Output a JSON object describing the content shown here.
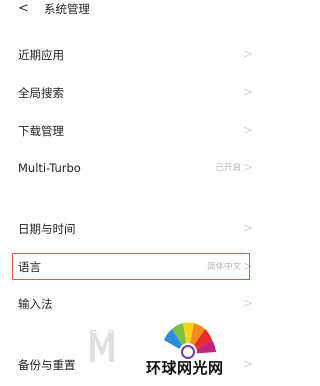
{
  "header": {
    "back_icon": "chevron-left-icon",
    "back_glyph": "<",
    "title": "系统管理"
  },
  "settings": {
    "items": [
      {
        "label": "近期应用",
        "value": ""
      },
      {
        "label": "全局搜索",
        "value": ""
      },
      {
        "label": "下载管理",
        "value": ""
      },
      {
        "label": "Multi-Turbo",
        "value": "已开启"
      },
      {
        "label": "日期与时间",
        "value": ""
      },
      {
        "label": "语言",
        "value": "简体中文"
      },
      {
        "label": "输入法",
        "value": ""
      },
      {
        "label": "备份与重置",
        "value": ""
      }
    ],
    "chevron_glyph": ">"
  },
  "highlight": {
    "color": "#d75a5a",
    "target": "语言"
  },
  "watermark": {
    "text": "环球网光网"
  }
}
